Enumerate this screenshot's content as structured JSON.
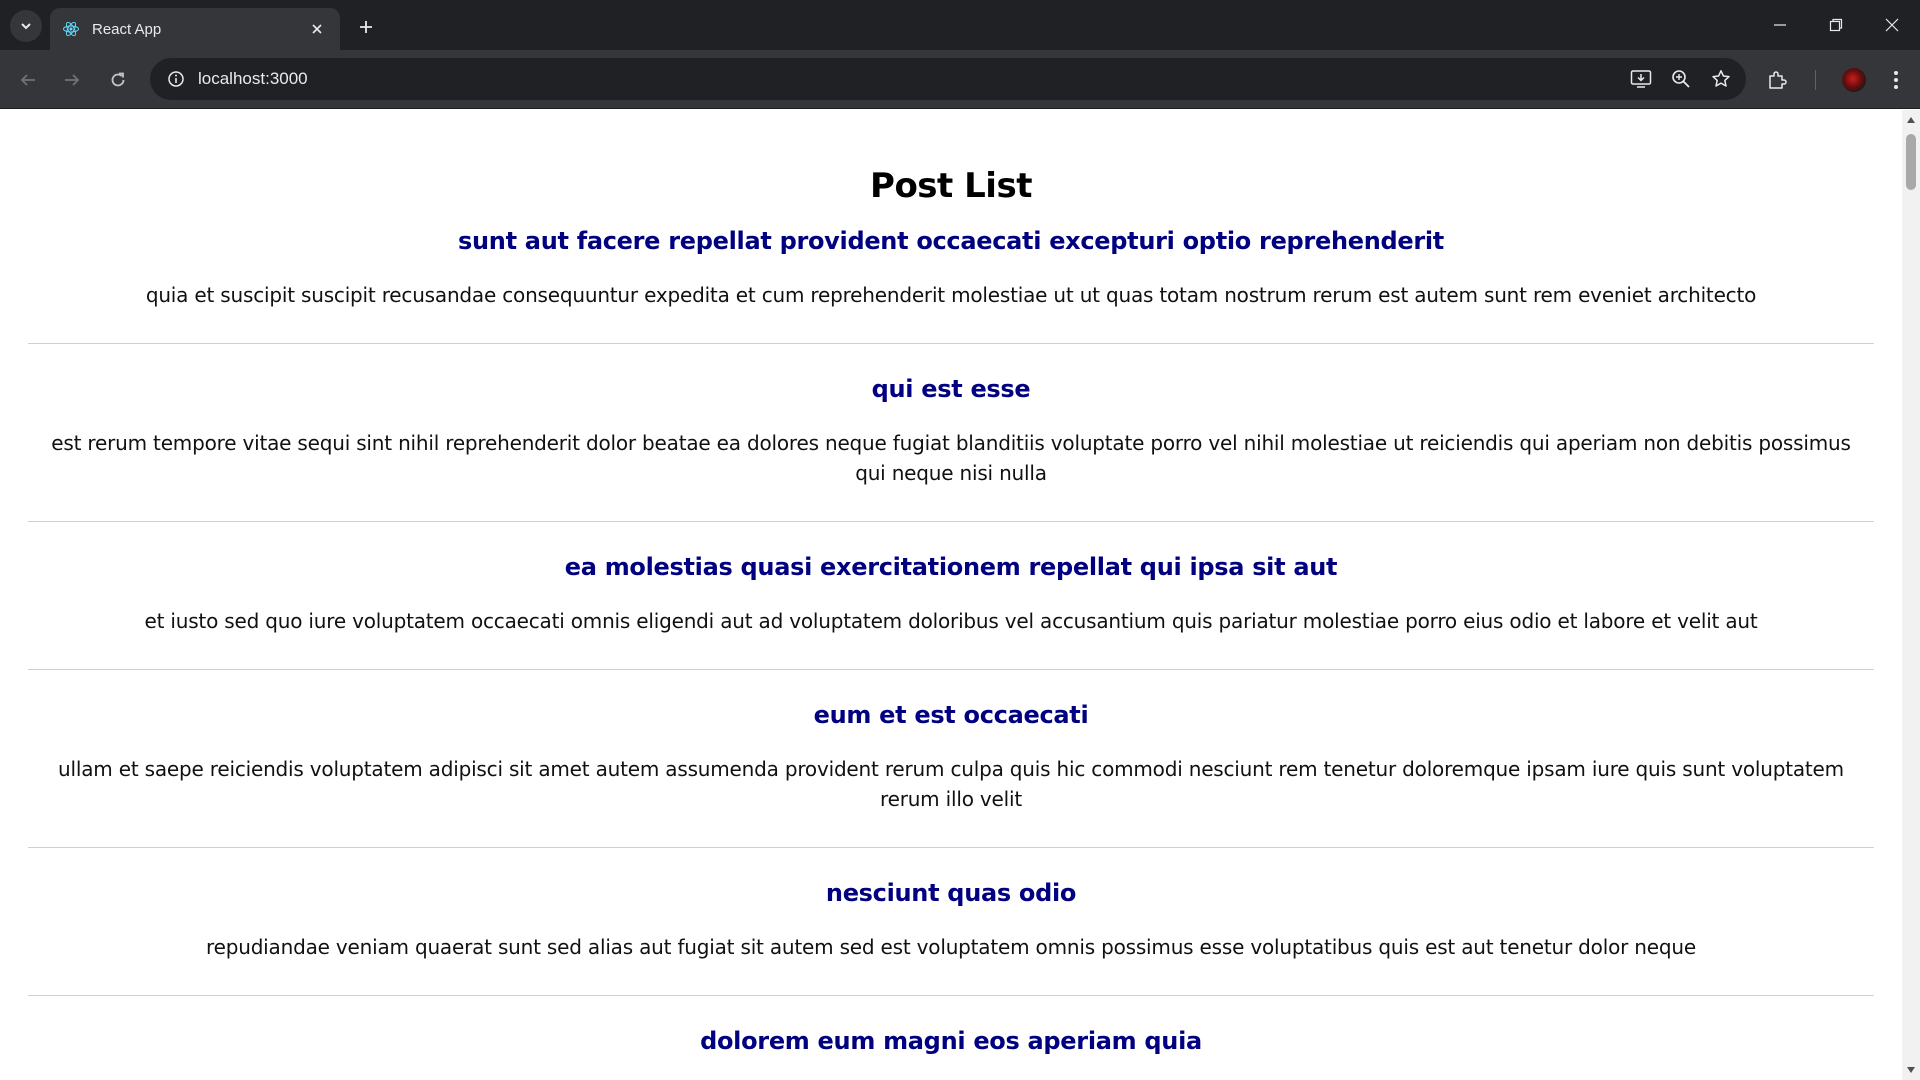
{
  "browser": {
    "tab_title": "React App",
    "url": "localhost:3000"
  },
  "page": {
    "title": "Post List",
    "posts": [
      {
        "title": "sunt aut facere repellat provident occaecati excepturi optio reprehenderit",
        "body": "quia et suscipit suscipit recusandae consequuntur expedita et cum reprehenderit molestiae ut ut quas totam nostrum rerum est autem sunt rem eveniet architecto"
      },
      {
        "title": "qui est esse",
        "body": "est rerum tempore vitae sequi sint nihil reprehenderit dolor beatae ea dolores neque fugiat blanditiis voluptate porro vel nihil molestiae ut reiciendis qui aperiam non debitis possimus qui neque nisi nulla"
      },
      {
        "title": "ea molestias quasi exercitationem repellat qui ipsa sit aut",
        "body": "et iusto sed quo iure voluptatem occaecati omnis eligendi aut ad voluptatem doloribus vel accusantium quis pariatur molestiae porro eius odio et labore et velit aut"
      },
      {
        "title": "eum et est occaecati",
        "body": "ullam et saepe reiciendis voluptatem adipisci sit amet autem assumenda provident rerum culpa quis hic commodi nesciunt rem tenetur doloremque ipsam iure quis sunt voluptatem rerum illo velit"
      },
      {
        "title": "nesciunt quas odio",
        "body": "repudiandae veniam quaerat sunt sed alias aut fugiat sit autem sed est voluptatem omnis possimus esse voluptatibus quis est aut tenetur dolor neque"
      },
      {
        "title": "dolorem eum magni eos aperiam quia",
        "body": ""
      }
    ]
  },
  "colors": {
    "post_title": "#000080",
    "chrome_dark": "#202124",
    "chrome_toolbar": "#35363a"
  },
  "icons": {
    "tab_search": "chevron-down-icon",
    "favicon": "react-icon",
    "close": "close-icon",
    "new_tab": "plus-icon",
    "back": "arrow-left-icon",
    "forward": "arrow-right-icon",
    "reload": "reload-icon",
    "site_info": "info-icon",
    "install": "install-app-icon",
    "zoom": "zoom-icon",
    "bookmark": "star-icon",
    "extensions": "puzzle-icon",
    "profile": "avatar",
    "menu": "kebab-menu-icon"
  }
}
